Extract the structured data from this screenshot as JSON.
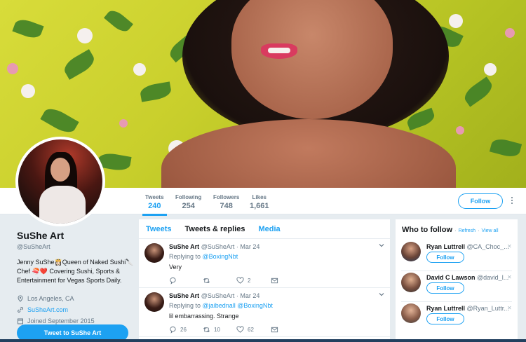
{
  "profile": {
    "name": "SuShe Art",
    "handle": "@SuSheArt",
    "bio": "Jenny SuShe👸🏻Queen of Naked Sushi🔪 Chef 🍣❤️ Covering Sushi, Sports & Entertainment for Vegas Sports Daily.",
    "location": "Los Angeles, CA",
    "website": "SuSheArt.com",
    "joined": "Joined September 2015",
    "tweet_to_label": "Tweet to SuShe Art"
  },
  "stats": [
    {
      "label": "Tweets",
      "value": "240"
    },
    {
      "label": "Following",
      "value": "254"
    },
    {
      "label": "Followers",
      "value": "748"
    },
    {
      "label": "Likes",
      "value": "1,661"
    }
  ],
  "header": {
    "follow_label": "Follow"
  },
  "tabs": [
    "Tweets",
    "Tweets & replies",
    "Media"
  ],
  "tweets": [
    {
      "name": "SuShe Art",
      "handle": "@SuSheArt",
      "date": "· Mar 24",
      "replying_prefix": "Replying to",
      "replying_to": "@BoxingNbt",
      "text": "Very",
      "replies": "",
      "retweets": "",
      "likes": "2"
    },
    {
      "name": "SuShe Art",
      "handle": "@SuSheArt",
      "date": "· Mar 24",
      "replying_prefix": "Replying to",
      "replying_to": "@jaibednall @BoxingNbt",
      "text": "lil embarrassing.  Strange",
      "replies": "26",
      "retweets": "10",
      "likes": "62"
    }
  ],
  "who_to_follow": {
    "title": "Who to follow",
    "refresh": "Refresh",
    "separator": "·",
    "view_all": "View all",
    "suggestions": [
      {
        "name": "Ryan Luttrell",
        "handle": "@CA_Choc_...",
        "follow_label": "Follow",
        "dismiss": "✕"
      },
      {
        "name": "David C Lawson",
        "handle": "@david_l...",
        "follow_label": "Follow",
        "dismiss": "✕"
      },
      {
        "name": "Ryan Luttrell",
        "handle": "@Ryan_Luttr...",
        "follow_label": "Follow",
        "dismiss": "✕"
      }
    ]
  },
  "colors": {
    "accent": "#1da1f2",
    "background": "#e6ecf0",
    "like_heart": "#e0245e"
  }
}
